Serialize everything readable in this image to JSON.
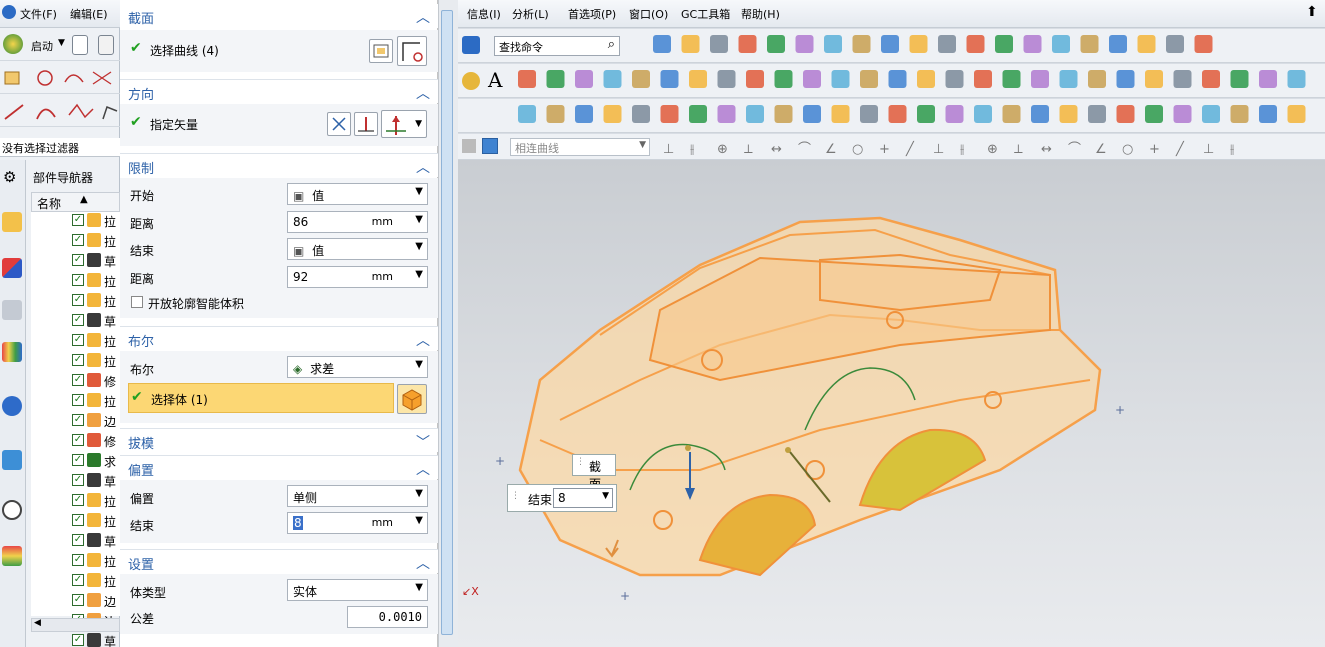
{
  "left_app": {
    "menu": [
      "文件(F)",
      "编辑(E)"
    ],
    "start_label": "启动",
    "filter_text": "没有选择过滤器",
    "navigator_title": "部件导航器",
    "column_name": "名称",
    "nav_items": [
      "拉",
      "拉",
      "草",
      "拉",
      "拉",
      "草",
      "拉",
      "拉",
      "修",
      "拉",
      "边",
      "修",
      "求",
      "草",
      "拉",
      "拉",
      "草",
      "拉",
      "拉",
      "边",
      "边",
      "草"
    ]
  },
  "dialog": {
    "section_section": "截面",
    "select_curve": "选择曲线 (4)",
    "section_direction": "方向",
    "specify_vector": "指定矢量",
    "section_limits": "限制",
    "start_label": "开始",
    "start_value": "值",
    "distance_label": "距离",
    "distance1_value": "86",
    "unit_mm": "mm",
    "end_label": "结束",
    "end_value": "值",
    "distance2_value": "92",
    "open_profile": "开放轮廓智能体积",
    "section_boolean": "布尔",
    "boolean_label": "布尔",
    "boolean_value": "求差",
    "select_body": "选择体 (1)",
    "section_draft": "拔模",
    "section_offset": "偏置",
    "offset_label": "偏置",
    "offset_value": "单侧",
    "offset_end_label": "结束",
    "offset_end_value": "8",
    "section_settings": "设置",
    "body_type_label": "体类型",
    "body_type_value": "实体",
    "tolerance_label": "公差",
    "tolerance_value": "0.0010"
  },
  "right_app": {
    "menu": [
      "信息(I)",
      "分析(L)",
      "首选项(P)",
      "窗口(O)",
      "GC工具箱",
      "帮助(H)"
    ],
    "search_placeholder": "查找命令",
    "curve_rule": "相连曲线"
  },
  "viewport": {
    "tip_section": "截面",
    "tip_end_label": "结束",
    "tip_end_value": "8"
  },
  "colors": {
    "accent_blue": "#2e62a8",
    "selection_yellow": "#fcd774",
    "model_orange": "#f6a04a",
    "check_green": "#21a021"
  }
}
